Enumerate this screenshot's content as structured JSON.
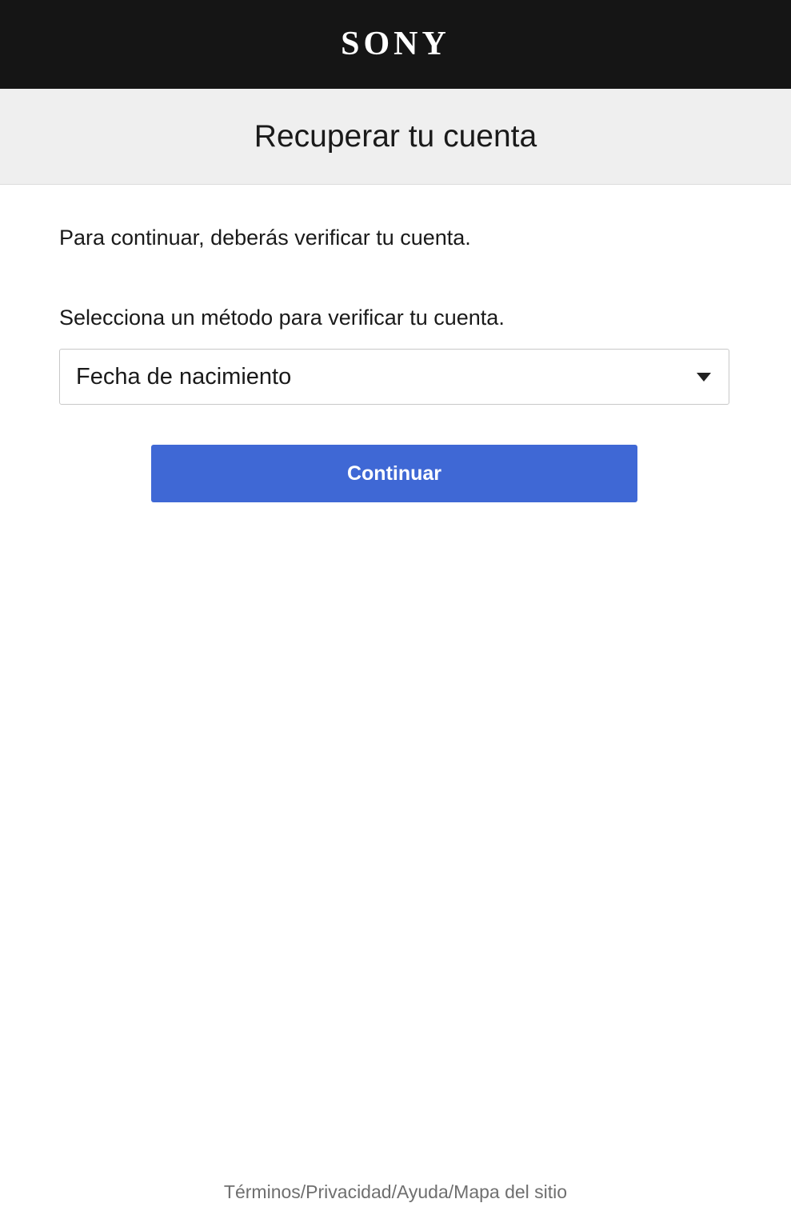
{
  "header": {
    "logo_text": "SONY",
    "background_color": "#151515"
  },
  "title_bar": {
    "title": "Recuperar tu cuenta"
  },
  "main": {
    "intro_text": "Para continuar, deberás verificar tu cuenta.",
    "method_label": "Selecciona un método para verificar tu cuenta.",
    "method_select": {
      "selected_value": "Fecha de nacimiento",
      "icon": "caret-down-icon"
    },
    "continue_button": {
      "label": "Continuar",
      "color": "#3f68d5"
    }
  },
  "footer": {
    "links": [
      {
        "label": "Términos"
      },
      {
        "label": "Privacidad"
      },
      {
        "label": "Ayuda"
      },
      {
        "label": "Mapa del sitio"
      }
    ],
    "separator": "/"
  }
}
